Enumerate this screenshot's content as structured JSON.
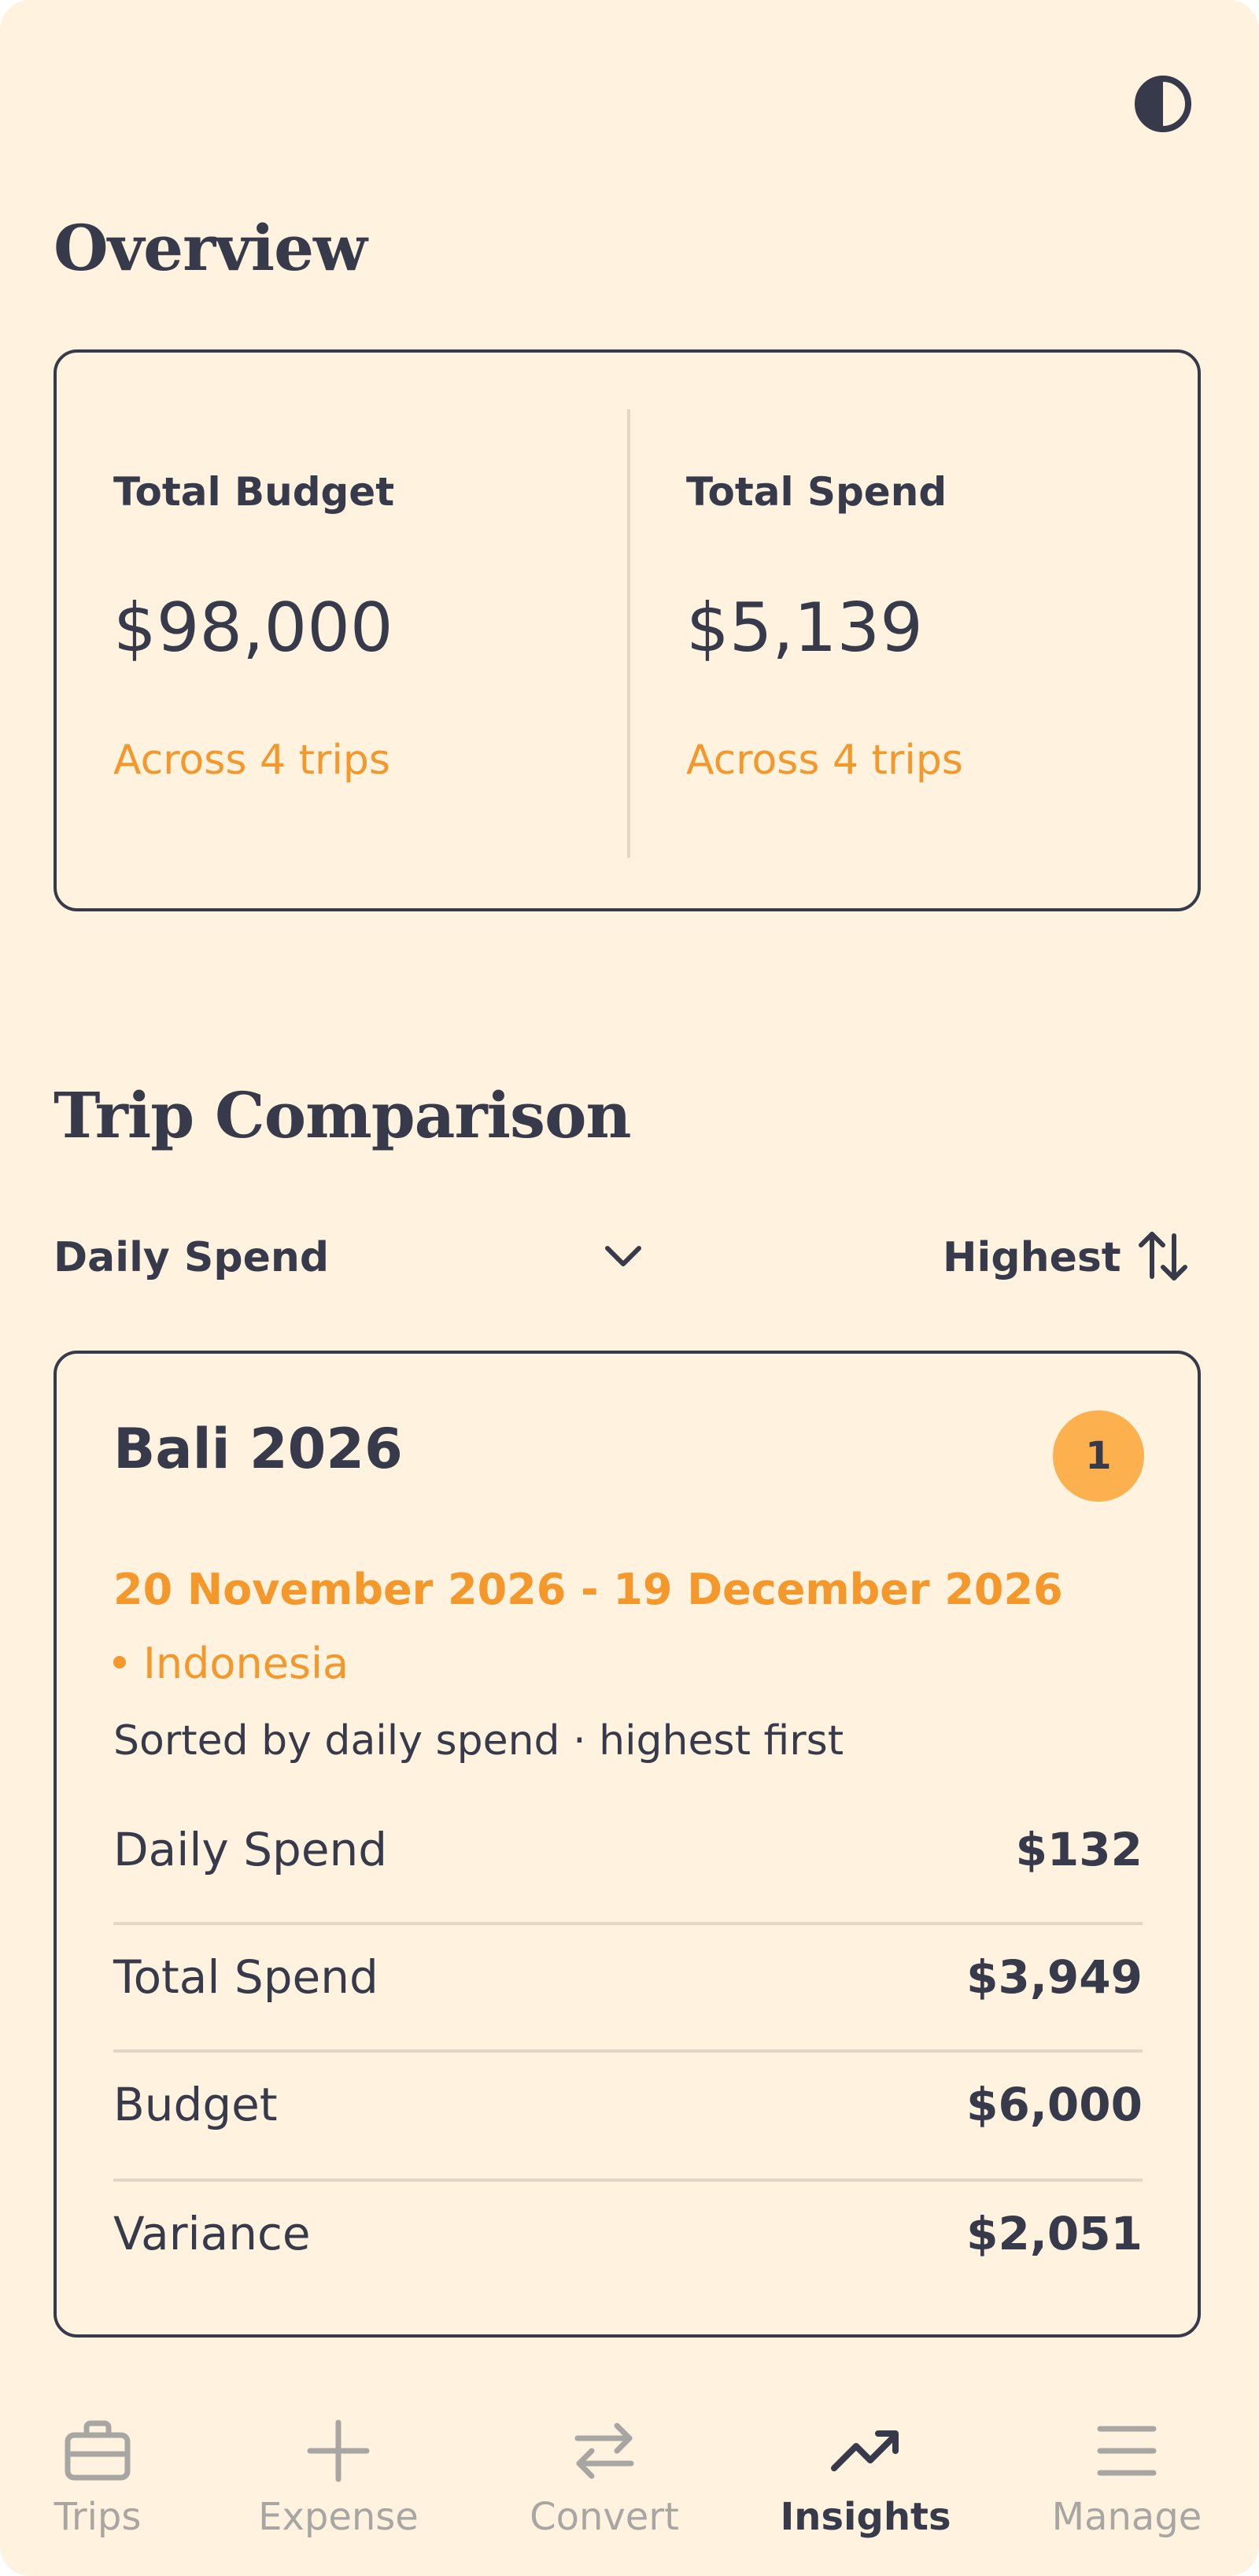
{
  "colors": {
    "background": "#fff2df",
    "text": "#363a4a",
    "accent": "#f4982c",
    "badge": "#fdb04e",
    "divider": "#e3d6c4",
    "nav_inactive": "#a8a6a2"
  },
  "header": {
    "theme_toggle_icon": "contrast-icon"
  },
  "overview": {
    "title": "Overview",
    "total_budget": {
      "label": "Total Budget",
      "value": "$98,000",
      "subtext": "Across 4 trips"
    },
    "total_spend": {
      "label": "Total Spend",
      "value": "$5,139",
      "subtext": "Across 4 trips"
    }
  },
  "comparison": {
    "title": "Trip Comparison",
    "metric_select": {
      "selected": "Daily Spend",
      "icon": "chevron-down-icon"
    },
    "order_toggle": {
      "label": "Highest",
      "icon": "sort-arrows-icon"
    },
    "trips": [
      {
        "name": "Bali 2026",
        "rank": "1",
        "dates": "20 November 2026 - 19 December 2026",
        "country": "Indonesia",
        "sort_note": "Sorted by daily spend · highest first",
        "metrics": [
          {
            "label": "Daily Spend",
            "value": "$132"
          },
          {
            "label": "Total Spend",
            "value": "$3,949"
          },
          {
            "label": "Budget",
            "value": "$6,000"
          },
          {
            "label": "Variance",
            "value": "$2,051"
          }
        ]
      }
    ]
  },
  "nav": {
    "active": "Insights",
    "items": [
      {
        "label": "Trips",
        "icon": "briefcase-icon"
      },
      {
        "label": "Expense",
        "icon": "plus-icon"
      },
      {
        "label": "Convert",
        "icon": "exchange-arrows-icon"
      },
      {
        "label": "Insights",
        "icon": "trend-up-icon"
      },
      {
        "label": "Manage",
        "icon": "menu-icon"
      }
    ]
  }
}
